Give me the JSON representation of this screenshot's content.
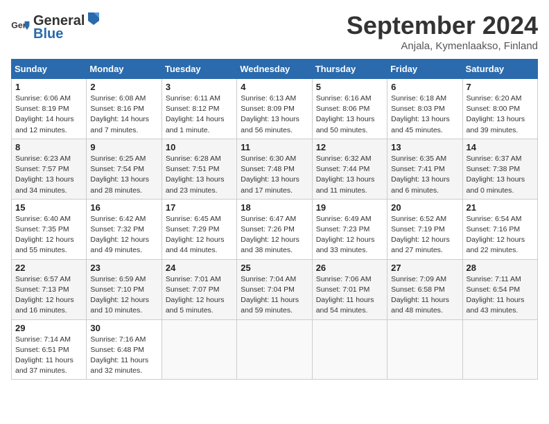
{
  "header": {
    "logo_general": "General",
    "logo_blue": "Blue",
    "month_title": "September 2024",
    "location": "Anjala, Kymenlaakso, Finland"
  },
  "weekdays": [
    "Sunday",
    "Monday",
    "Tuesday",
    "Wednesday",
    "Thursday",
    "Friday",
    "Saturday"
  ],
  "weeks": [
    [
      {
        "day": "1",
        "sunrise": "6:06 AM",
        "sunset": "8:19 PM",
        "daylight": "14 hours and 12 minutes."
      },
      {
        "day": "2",
        "sunrise": "6:08 AM",
        "sunset": "8:16 PM",
        "daylight": "14 hours and 7 minutes."
      },
      {
        "day": "3",
        "sunrise": "6:11 AM",
        "sunset": "8:12 PM",
        "daylight": "14 hours and 1 minute."
      },
      {
        "day": "4",
        "sunrise": "6:13 AM",
        "sunset": "8:09 PM",
        "daylight": "13 hours and 56 minutes."
      },
      {
        "day": "5",
        "sunrise": "6:16 AM",
        "sunset": "8:06 PM",
        "daylight": "13 hours and 50 minutes."
      },
      {
        "day": "6",
        "sunrise": "6:18 AM",
        "sunset": "8:03 PM",
        "daylight": "13 hours and 45 minutes."
      },
      {
        "day": "7",
        "sunrise": "6:20 AM",
        "sunset": "8:00 PM",
        "daylight": "13 hours and 39 minutes."
      }
    ],
    [
      {
        "day": "8",
        "sunrise": "6:23 AM",
        "sunset": "7:57 PM",
        "daylight": "13 hours and 34 minutes."
      },
      {
        "day": "9",
        "sunrise": "6:25 AM",
        "sunset": "7:54 PM",
        "daylight": "13 hours and 28 minutes."
      },
      {
        "day": "10",
        "sunrise": "6:28 AM",
        "sunset": "7:51 PM",
        "daylight": "13 hours and 23 minutes."
      },
      {
        "day": "11",
        "sunrise": "6:30 AM",
        "sunset": "7:48 PM",
        "daylight": "13 hours and 17 minutes."
      },
      {
        "day": "12",
        "sunrise": "6:32 AM",
        "sunset": "7:44 PM",
        "daylight": "13 hours and 11 minutes."
      },
      {
        "day": "13",
        "sunrise": "6:35 AM",
        "sunset": "7:41 PM",
        "daylight": "13 hours and 6 minutes."
      },
      {
        "day": "14",
        "sunrise": "6:37 AM",
        "sunset": "7:38 PM",
        "daylight": "13 hours and 0 minutes."
      }
    ],
    [
      {
        "day": "15",
        "sunrise": "6:40 AM",
        "sunset": "7:35 PM",
        "daylight": "12 hours and 55 minutes."
      },
      {
        "day": "16",
        "sunrise": "6:42 AM",
        "sunset": "7:32 PM",
        "daylight": "12 hours and 49 minutes."
      },
      {
        "day": "17",
        "sunrise": "6:45 AM",
        "sunset": "7:29 PM",
        "daylight": "12 hours and 44 minutes."
      },
      {
        "day": "18",
        "sunrise": "6:47 AM",
        "sunset": "7:26 PM",
        "daylight": "12 hours and 38 minutes."
      },
      {
        "day": "19",
        "sunrise": "6:49 AM",
        "sunset": "7:23 PM",
        "daylight": "12 hours and 33 minutes."
      },
      {
        "day": "20",
        "sunrise": "6:52 AM",
        "sunset": "7:19 PM",
        "daylight": "12 hours and 27 minutes."
      },
      {
        "day": "21",
        "sunrise": "6:54 AM",
        "sunset": "7:16 PM",
        "daylight": "12 hours and 22 minutes."
      }
    ],
    [
      {
        "day": "22",
        "sunrise": "6:57 AM",
        "sunset": "7:13 PM",
        "daylight": "12 hours and 16 minutes."
      },
      {
        "day": "23",
        "sunrise": "6:59 AM",
        "sunset": "7:10 PM",
        "daylight": "12 hours and 10 minutes."
      },
      {
        "day": "24",
        "sunrise": "7:01 AM",
        "sunset": "7:07 PM",
        "daylight": "12 hours and 5 minutes."
      },
      {
        "day": "25",
        "sunrise": "7:04 AM",
        "sunset": "7:04 PM",
        "daylight": "11 hours and 59 minutes."
      },
      {
        "day": "26",
        "sunrise": "7:06 AM",
        "sunset": "7:01 PM",
        "daylight": "11 hours and 54 minutes."
      },
      {
        "day": "27",
        "sunrise": "7:09 AM",
        "sunset": "6:58 PM",
        "daylight": "11 hours and 48 minutes."
      },
      {
        "day": "28",
        "sunrise": "7:11 AM",
        "sunset": "6:54 PM",
        "daylight": "11 hours and 43 minutes."
      }
    ],
    [
      {
        "day": "29",
        "sunrise": "7:14 AM",
        "sunset": "6:51 PM",
        "daylight": "11 hours and 37 minutes."
      },
      {
        "day": "30",
        "sunrise": "7:16 AM",
        "sunset": "6:48 PM",
        "daylight": "11 hours and 32 minutes."
      },
      null,
      null,
      null,
      null,
      null
    ]
  ]
}
